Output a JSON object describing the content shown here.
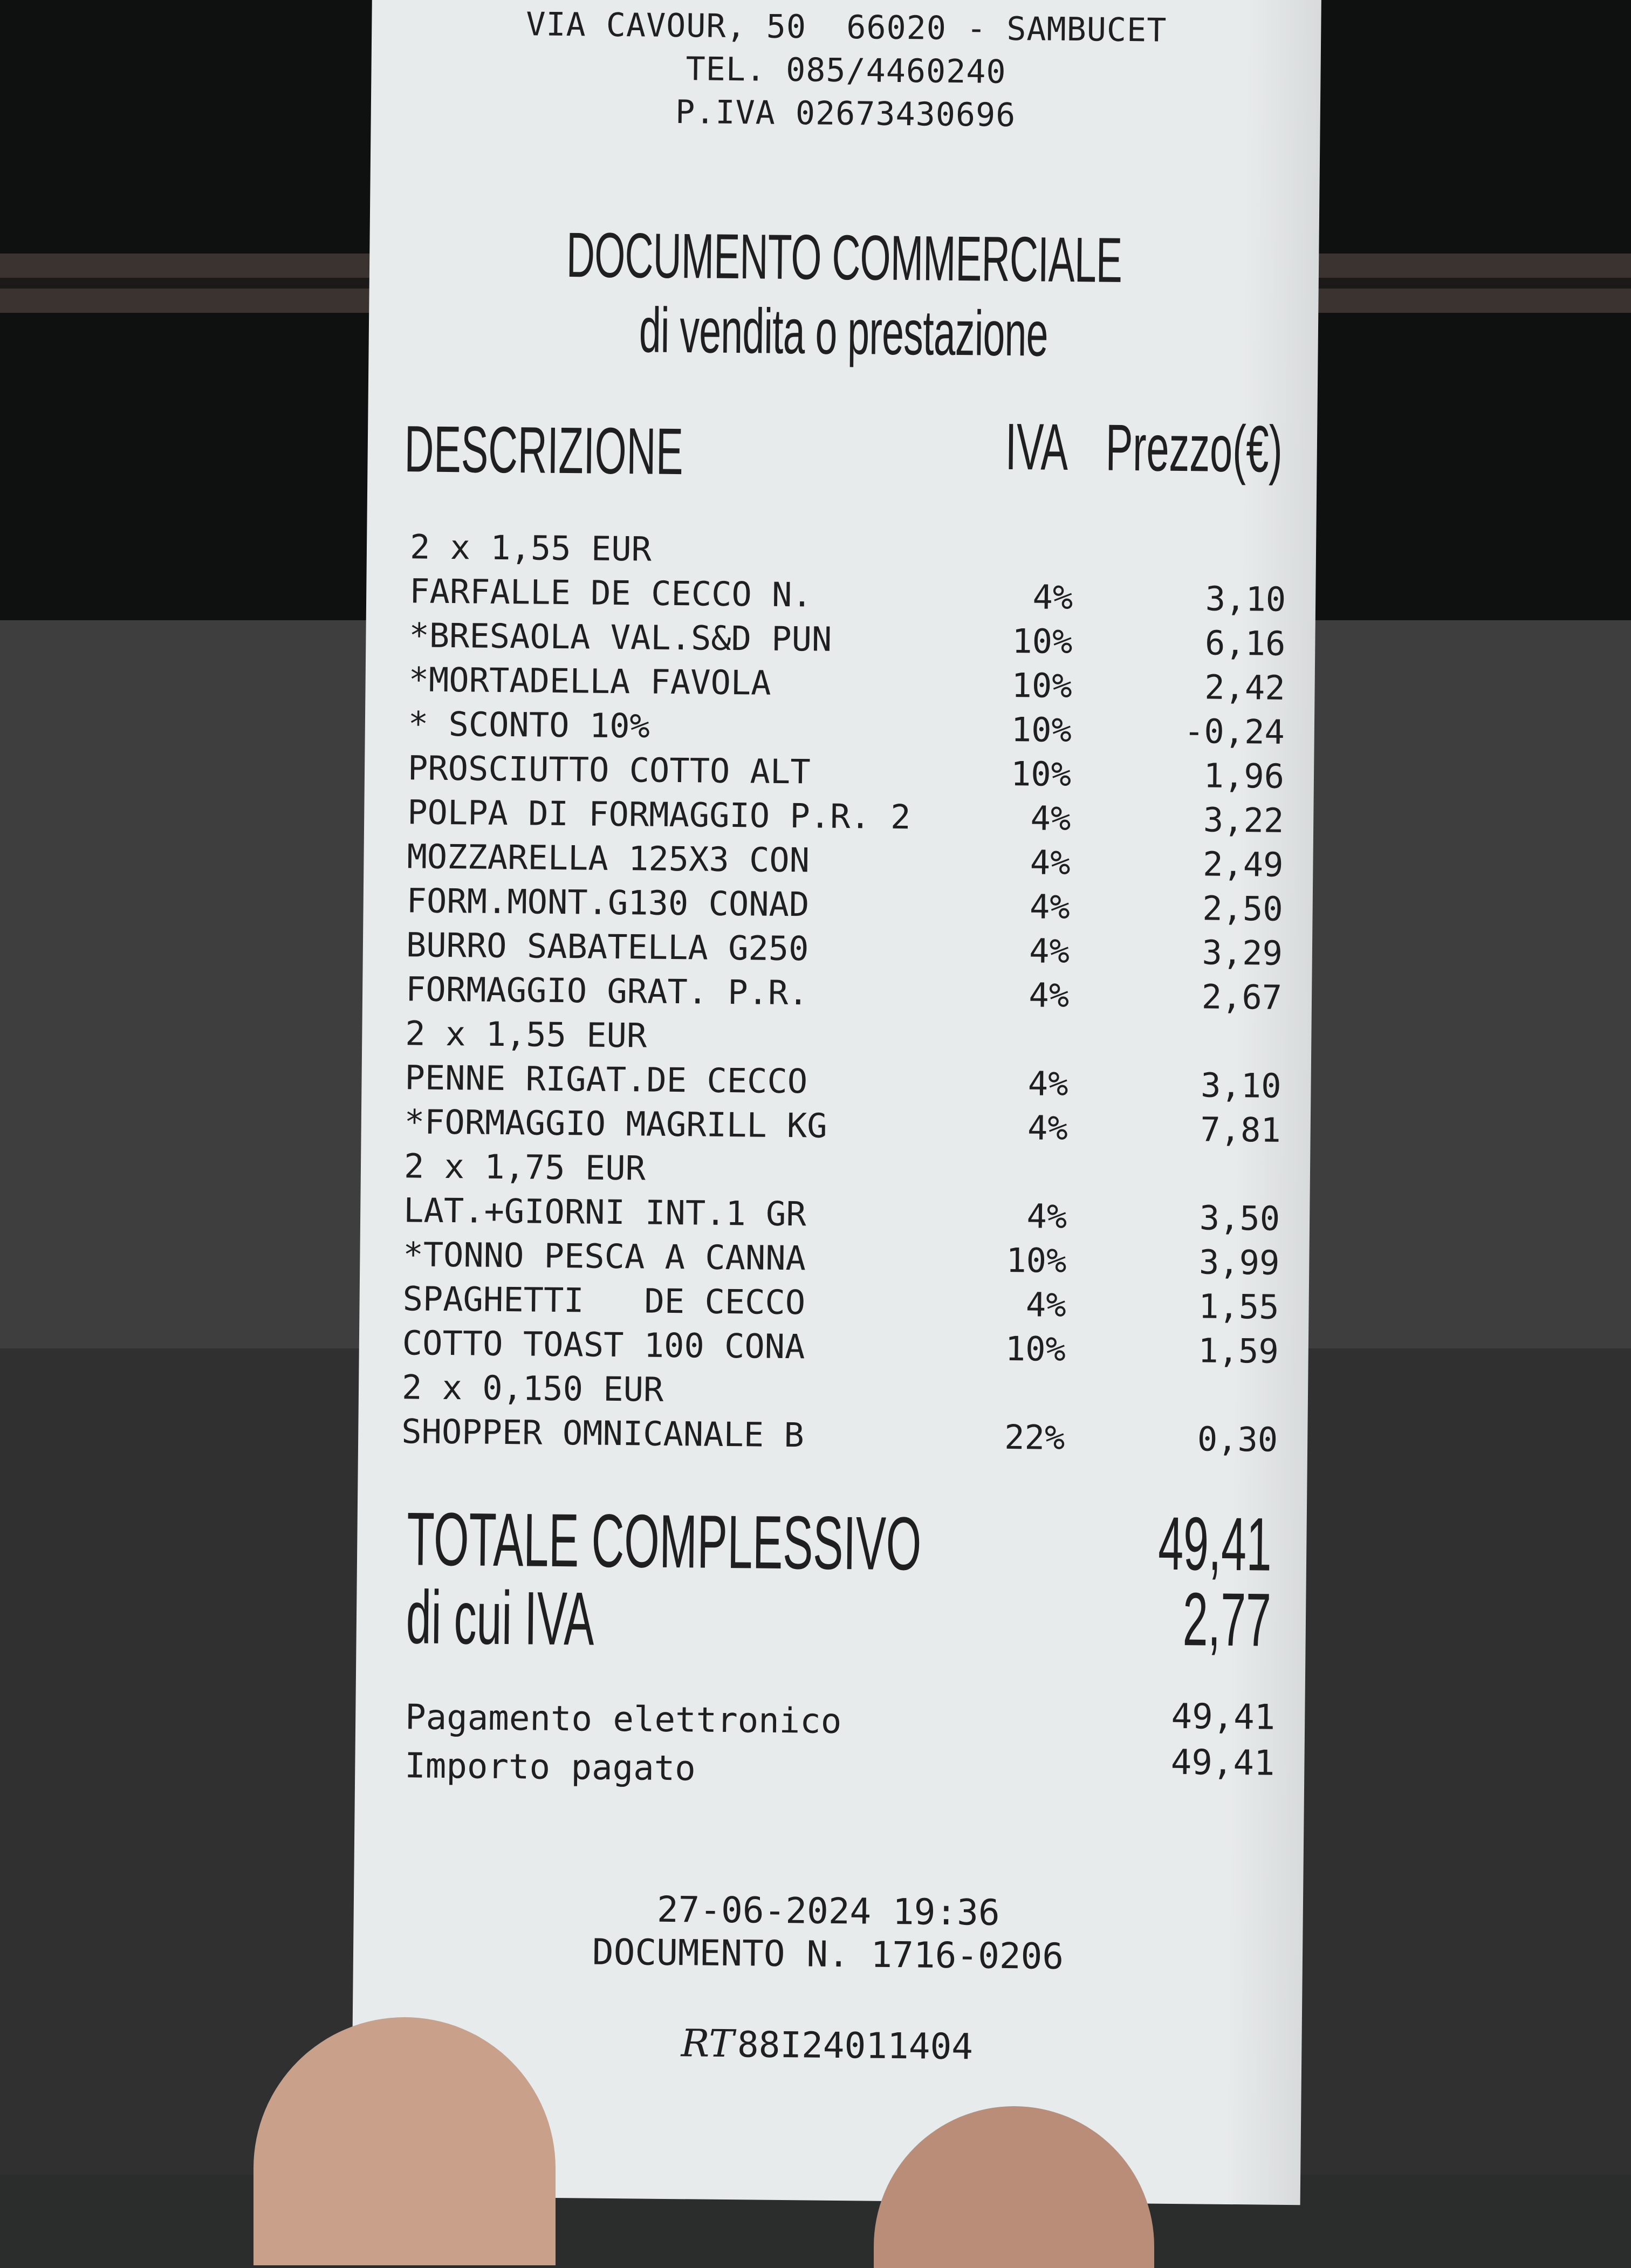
{
  "header": {
    "address": "VIA CAVOUR, 50  66020 - SAMBUCET",
    "phone": "TEL. 085/4460240",
    "vat": "P.IVA 02673430696"
  },
  "title": {
    "line1": "DOCUMENTO COMMERCIALE",
    "line2": "di vendita o prestazione"
  },
  "columns": {
    "description": "DESCRIZIONE",
    "iva": "IVA",
    "price": "Prezzo(€)"
  },
  "items": [
    {
      "desc": "2 x 1,55 EUR",
      "iva": "",
      "price": ""
    },
    {
      "desc": "FARFALLE DE CECCO N.",
      "iva": "4%",
      "price": "3,10"
    },
    {
      "desc": "*BRESAOLA VAL.S&D PUN",
      "iva": "10%",
      "price": "6,16"
    },
    {
      "desc": "*MORTADELLA FAVOLA",
      "iva": "10%",
      "price": "2,42"
    },
    {
      "desc": "* SCONTO 10%",
      "iva": "10%",
      "price": "-0,24"
    },
    {
      "desc": "PROSCIUTTO COTTO ALT",
      "iva": "10%",
      "price": "1,96"
    },
    {
      "desc": "POLPA DI FORMAGGIO P.R. 2",
      "iva": "4%",
      "price": "3,22"
    },
    {
      "desc": "MOZZARELLA 125X3 CON",
      "iva": "4%",
      "price": "2,49"
    },
    {
      "desc": "FORM.MONT.G130 CONAD",
      "iva": "4%",
      "price": "2,50"
    },
    {
      "desc": "BURRO SABATELLA G250",
      "iva": "4%",
      "price": "3,29"
    },
    {
      "desc": "FORMAGGIO GRAT. P.R.",
      "iva": "4%",
      "price": "2,67"
    },
    {
      "desc": "2 x 1,55 EUR",
      "iva": "",
      "price": ""
    },
    {
      "desc": "PENNE RIGAT.DE CECCO",
      "iva": "4%",
      "price": "3,10"
    },
    {
      "desc": "*FORMAGGIO MAGRILL KG",
      "iva": "4%",
      "price": "7,81"
    },
    {
      "desc": "2 x 1,75 EUR",
      "iva": "",
      "price": ""
    },
    {
      "desc": "LAT.+GIORNI INT.1 GR",
      "iva": "4%",
      "price": "3,50"
    },
    {
      "desc": "*TONNO PESCA A CANNA",
      "iva": "10%",
      "price": "3,99"
    },
    {
      "desc": "SPAGHETTI   DE CECCO",
      "iva": "4%",
      "price": "1,55"
    },
    {
      "desc": "COTTO TOAST 100 CONA",
      "iva": "10%",
      "price": "1,59"
    },
    {
      "desc": "2 x 0,150 EUR",
      "iva": "",
      "price": ""
    },
    {
      "desc": "SHOPPER OMNICANALE B",
      "iva": "22%",
      "price": "0,30"
    }
  ],
  "totals": {
    "total_label": "TOTALE COMPLESSIVO",
    "total_value": "49,41",
    "vat_label": "di cui IVA",
    "vat_value": "2,77"
  },
  "payment": {
    "method_label": "Pagamento elettronico",
    "method_value": "49,41",
    "paid_label": "Importo pagato",
    "paid_value": "49,41"
  },
  "footer": {
    "datetime": "27-06-2024 19:36",
    "document": "DOCUMENTO N. 1716-0206",
    "rt_mark": "RT",
    "rt_code": "88I24011404"
  }
}
